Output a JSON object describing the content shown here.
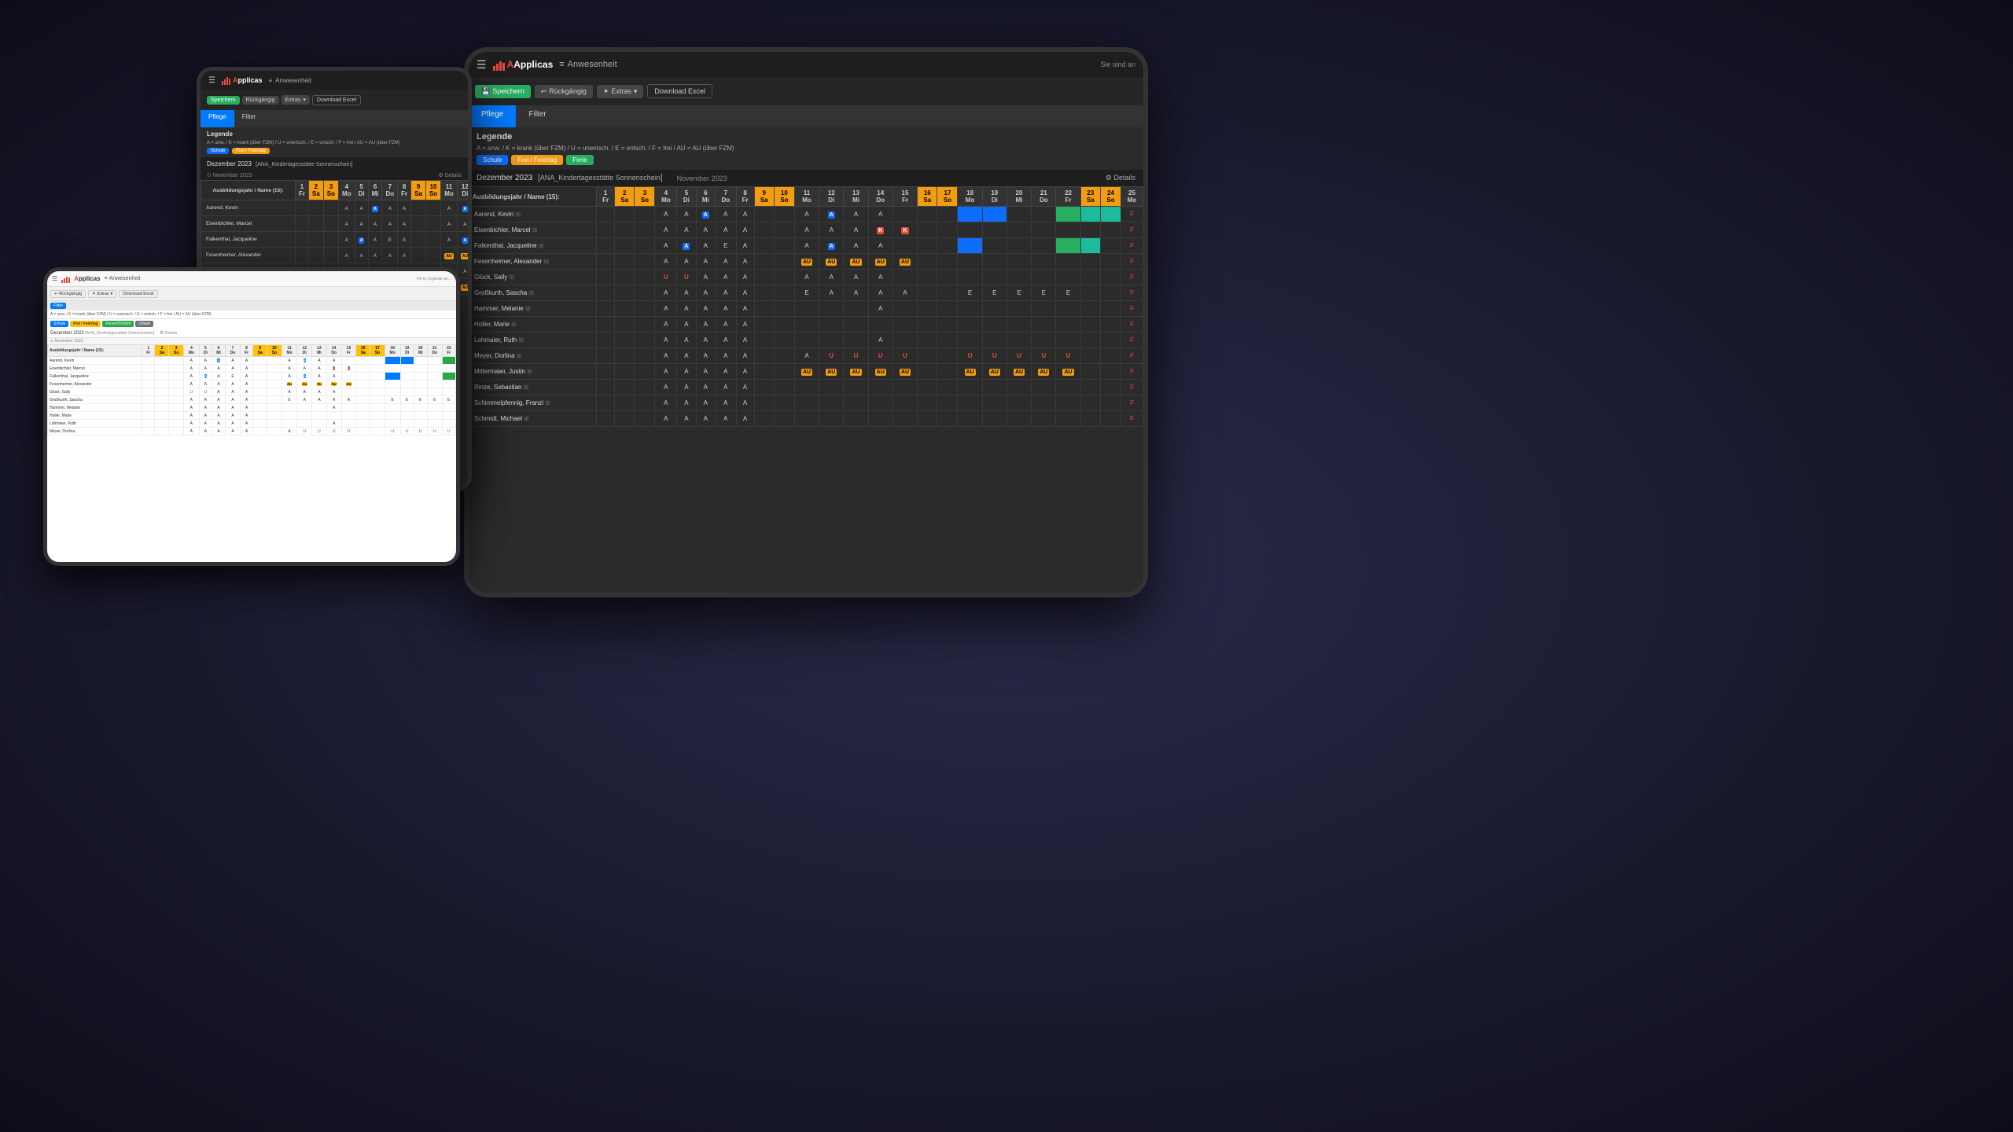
{
  "app": {
    "name": "Applicas",
    "title": "Anwesenheit",
    "user_text": "Sie sind an"
  },
  "toolbar": {
    "save_label": "Speichern",
    "undo_label": "Rückgängig",
    "extras_label": "Extras",
    "download_excel_label": "Download Excel"
  },
  "tabs": {
    "pflege": "Pflege",
    "filter": "Filter"
  },
  "legend": {
    "title": "Legende",
    "text": "A = anw. / K = krank (über FZM) / U = unentsch. / E = entsch. / F = frei / AU = AU (über FZM)",
    "btn_schule": "Schule",
    "btn_frei": "Frei / Feiertag",
    "btn_ferie": "Ferie"
  },
  "calendar": {
    "current_month": "Dezember 2023",
    "location": "ANA_Kindertagesstätte Sonnenschein",
    "prev_month": "November 2023",
    "details_label": "Details",
    "header_label": "Ausbildungsjahr / Name (15):",
    "days": [
      {
        "num": "1",
        "day": "Fr",
        "weekend": false
      },
      {
        "num": "2",
        "day": "Sa",
        "weekend": true
      },
      {
        "num": "3",
        "day": "So",
        "weekend": true
      },
      {
        "num": "4",
        "day": "Mo",
        "weekend": false
      },
      {
        "num": "5",
        "day": "Di",
        "weekend": false
      },
      {
        "num": "6",
        "day": "Mi",
        "weekend": false
      },
      {
        "num": "7",
        "day": "Do",
        "weekend": false
      },
      {
        "num": "8",
        "day": "Fr",
        "weekend": false
      },
      {
        "num": "9",
        "day": "Sa",
        "weekend": true
      },
      {
        "num": "10",
        "day": "So",
        "weekend": true
      },
      {
        "num": "11",
        "day": "Mo",
        "weekend": false
      },
      {
        "num": "12",
        "day": "Di",
        "weekend": false
      },
      {
        "num": "13",
        "day": "Mi",
        "weekend": false
      },
      {
        "num": "14",
        "day": "Do",
        "weekend": false
      },
      {
        "num": "15",
        "day": "Fr",
        "weekend": false
      },
      {
        "num": "16",
        "day": "Sa",
        "weekend": true
      },
      {
        "num": "17",
        "day": "So",
        "weekend": true
      },
      {
        "num": "18",
        "day": "Mo",
        "weekend": false
      },
      {
        "num": "19",
        "day": "Di",
        "weekend": false
      },
      {
        "num": "20",
        "day": "Mi",
        "weekend": false
      },
      {
        "num": "21",
        "day": "Do",
        "weekend": false
      },
      {
        "num": "22",
        "day": "Fr",
        "weekend": false
      },
      {
        "num": "23",
        "day": "Sa",
        "weekend": true
      },
      {
        "num": "24",
        "day": "So",
        "weekend": true
      },
      {
        "num": "25",
        "day": "Mo",
        "weekend": false
      }
    ],
    "students": [
      {
        "name": "Aarend, Kevin",
        "data": {
          "4": "A",
          "5": "A",
          "6": "A-blue",
          "7": "A",
          "8": "A",
          "11": "A",
          "12": "A-blue",
          "13": "A",
          "14": "A",
          "18": "blue",
          "19": "blue",
          "22": "green",
          "23": "teal",
          "25": "F"
        }
      },
      {
        "name": "Eisenbichler, Marcel",
        "data": {
          "4": "A",
          "5": "A",
          "6": "A",
          "7": "A",
          "8": "A",
          "11": "A",
          "12": "A",
          "13": "A",
          "14": "K",
          "15": "K",
          "25": "F"
        }
      },
      {
        "name": "Falkenthal, Jacqueline",
        "data": {
          "4": "A",
          "5": "A-blue",
          "6": "A",
          "7": "E",
          "8": "A",
          "11": "A",
          "12": "A-blue",
          "13": "A",
          "14": "A",
          "18": "blue",
          "22": "green",
          "23": "teal",
          "25": "F"
        }
      },
      {
        "name": "Fesenheimer, Alexander",
        "data": {
          "4": "A",
          "5": "A",
          "6": "A",
          "7": "A",
          "8": "A",
          "11": "AU",
          "12": "AU",
          "13": "AU",
          "14": "AU",
          "15": "AU",
          "25": "F"
        }
      },
      {
        "name": "Glück, Sally",
        "data": {
          "4": "U",
          "5": "U",
          "6": "A",
          "7": "A",
          "8": "A",
          "11": "A",
          "12": "A",
          "13": "A",
          "14": "A",
          "25": "F"
        }
      },
      {
        "name": "Großkurth, Sascha",
        "data": {
          "4": "A",
          "5": "A",
          "6": "A",
          "7": "A",
          "8": "A",
          "11": "E",
          "12": "A",
          "13": "A",
          "14": "A",
          "15": "A",
          "18": "E",
          "19": "E",
          "20": "E",
          "21": "E",
          "22": "E",
          "25": "F"
        }
      },
      {
        "name": "Hammer, Melanie",
        "data": {
          "4": "A",
          "5": "A",
          "6": "A",
          "7": "A",
          "8": "A",
          "14": "A",
          "25": "F"
        }
      },
      {
        "name": "Holler, Marie",
        "data": {
          "4": "A",
          "5": "A",
          "6": "A",
          "7": "A",
          "8": "A",
          "25": "F"
        }
      },
      {
        "name": "Lohmaier, Ruth",
        "data": {
          "4": "A",
          "5": "A",
          "6": "A",
          "7": "A",
          "8": "A",
          "14": "A",
          "25": "F"
        }
      },
      {
        "name": "Meyer, Dorlina",
        "data": {
          "4": "A",
          "5": "A",
          "6": "A",
          "7": "A",
          "8": "A",
          "11": "A",
          "12": "U",
          "13": "U",
          "14": "U",
          "15": "U",
          "18": "U",
          "19": "U",
          "20": "U",
          "21": "U",
          "22": "U",
          "25": "F"
        }
      },
      {
        "name": "Mittermaier, Justin",
        "data": {
          "4": "A",
          "5": "A",
          "6": "A",
          "7": "A",
          "8": "A",
          "11": "AU",
          "12": "AU",
          "13": "AU",
          "14": "AU",
          "15": "AU",
          "18": "AU",
          "19": "AU",
          "20": "AU",
          "21": "AU",
          "22": "AU",
          "25": "F"
        }
      },
      {
        "name": "Rinze, Sebastian",
        "data": {
          "4": "A",
          "5": "A",
          "6": "A",
          "7": "A",
          "8": "A",
          "25": "F"
        }
      },
      {
        "name": "Schimmelpfennig, Franzi",
        "data": {
          "4": "A",
          "5": "A",
          "6": "A",
          "7": "A",
          "8": "A",
          "25": "F"
        }
      },
      {
        "name": "Schmidt, Michael",
        "data": {
          "4": "A",
          "5": "A",
          "6": "A",
          "7": "A",
          "8": "A",
          "25": "F"
        }
      }
    ]
  }
}
